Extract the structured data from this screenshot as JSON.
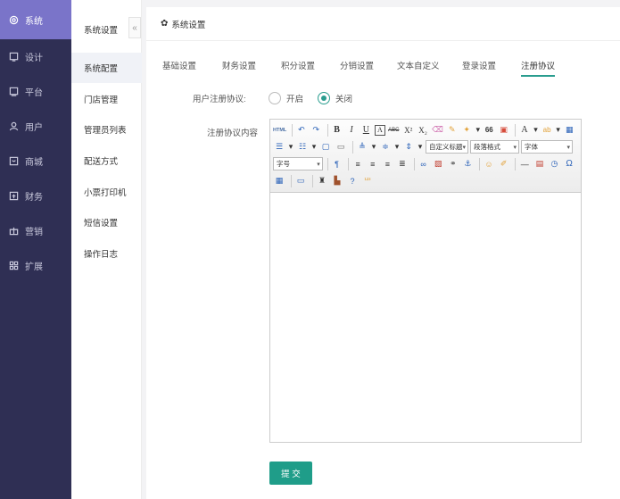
{
  "nav": [
    {
      "label": "系统",
      "icon": "settings-icon",
      "active": true
    },
    {
      "label": "设计",
      "icon": "design-icon",
      "active": false
    },
    {
      "label": "平台",
      "icon": "platform-icon",
      "active": false
    },
    {
      "label": "用户",
      "icon": "user-icon",
      "active": false
    },
    {
      "label": "商城",
      "icon": "shop-icon",
      "active": false
    },
    {
      "label": "财务",
      "icon": "finance-icon",
      "active": false
    },
    {
      "label": "营销",
      "icon": "gift-icon",
      "active": false
    },
    {
      "label": "扩展",
      "icon": "grid-icon",
      "active": false
    }
  ],
  "subnav": {
    "title": "系统设置",
    "collapse": "«",
    "items": [
      "系统配置",
      "门店管理",
      "管理员列表",
      "配送方式",
      "小票打印机",
      "短信设置",
      "操作日志"
    ]
  },
  "main": {
    "header": "系统设置",
    "tabs": [
      "基础设置",
      "财务设置",
      "积分设置",
      "分销设置",
      "文本自定义",
      "登录设置",
      "注册协议"
    ],
    "active_tab": "注册协议",
    "register_label": "用户注册协议:",
    "option_on": "开启",
    "option_off": "关闭",
    "content_label": "注册协议内容",
    "editor": {
      "html": "HTML",
      "bold": "B",
      "italic": "I",
      "underline": "U",
      "abc": "ABC",
      "quote": "66",
      "font_color": "A",
      "custom_title": "自定义标题",
      "paragraph": "段落格式",
      "font": "字体",
      "font_size": "字号",
      "omega": "Ω"
    },
    "submit": "提 交"
  },
  "colors": {
    "accent": "#1f9d89",
    "nav_bg": "#2f2f54",
    "nav_active": "#7a74c9"
  }
}
